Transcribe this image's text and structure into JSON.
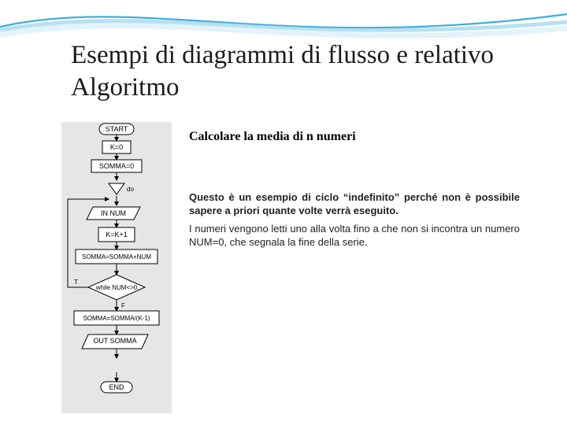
{
  "title": "Esempi di diagrammi di flusso e relativo Algoritmo",
  "subtitle": "Calcolare la media di n numeri",
  "paragraph1": "Questo è un esempio di ciclo “indefinito” perché non è possibile sapere a priori quante volte verrà eseguito.",
  "paragraph2": "I numeri vengono letti uno alla volta fino a che non si incontra un numero NUM=0, che segnala la fine della serie.",
  "flow": {
    "start": "START",
    "init_k": "K=0",
    "init_sum": "SOMMA=0",
    "do": "do",
    "read": "IN NUM",
    "inc_k": "K=K+1",
    "accum": "SOMMA=SOMMA+NUM",
    "cond": "while NUM<>0",
    "t": "T",
    "f": "F",
    "avg": "SOMMA=SOMMA/(K-1)",
    "out": "OUT SOMMA",
    "end": "END"
  },
  "colors": {
    "wave": "#2aa5d8"
  }
}
